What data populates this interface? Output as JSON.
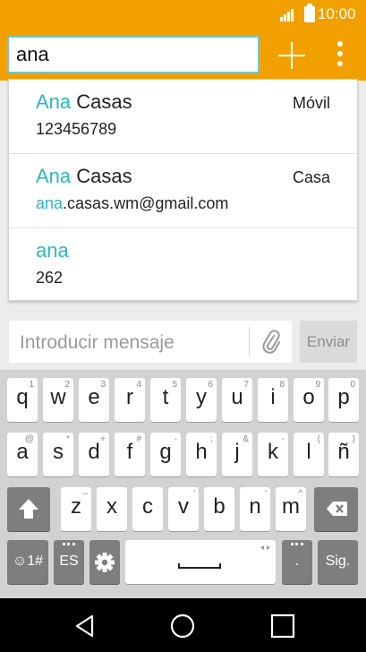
{
  "status": {
    "time": "10:00"
  },
  "search": {
    "query": "ana"
  },
  "suggestions": [
    {
      "name_match": "Ana",
      "name_rest": " Casas",
      "detail_match": "",
      "detail_rest": "123456789",
      "type": "Móvil"
    },
    {
      "name_match": "Ana",
      "name_rest": " Casas",
      "detail_match": "ana",
      "detail_rest": ".casas.wm@gmail.com",
      "type": "Casa"
    },
    {
      "name_match": "ana",
      "name_rest": "",
      "detail_match": "",
      "detail_rest": "262",
      "type": ""
    }
  ],
  "compose": {
    "placeholder": "Introducir mensaje",
    "send_label": "Enviar"
  },
  "keyboard": {
    "row1": [
      {
        "ch": "q",
        "hint": "1"
      },
      {
        "ch": "w",
        "hint": "2"
      },
      {
        "ch": "e",
        "hint": "3"
      },
      {
        "ch": "r",
        "hint": "4"
      },
      {
        "ch": "t",
        "hint": "5"
      },
      {
        "ch": "y",
        "hint": "6"
      },
      {
        "ch": "u",
        "hint": "7"
      },
      {
        "ch": "i",
        "hint": "8"
      },
      {
        "ch": "o",
        "hint": "9"
      },
      {
        "ch": "p",
        "hint": "0"
      }
    ],
    "row2": [
      {
        "ch": "a",
        "hint": "@"
      },
      {
        "ch": "s",
        "hint": "*"
      },
      {
        "ch": "d",
        "hint": "+"
      },
      {
        "ch": "f",
        "hint": "#"
      },
      {
        "ch": "g",
        "hint": "-"
      },
      {
        "ch": "h",
        "hint": ";"
      },
      {
        "ch": "j",
        "hint": "&"
      },
      {
        "ch": "k",
        "hint": "-"
      },
      {
        "ch": "l",
        "hint": "("
      },
      {
        "ch": "ñ",
        "hint": ")"
      }
    ],
    "row3": [
      {
        "ch": "z",
        "hint": "–"
      },
      {
        "ch": "x",
        "hint": ""
      },
      {
        "ch": "c",
        "hint": ""
      },
      {
        "ch": "v",
        "hint": "'"
      },
      {
        "ch": "b",
        "hint": ""
      },
      {
        "ch": "n",
        "hint": "'"
      },
      {
        "ch": "m",
        "hint": "^"
      }
    ],
    "emoji_label": "☺1#",
    "lang_label": "ES",
    "period_label": ".",
    "next_label": "Sig."
  }
}
